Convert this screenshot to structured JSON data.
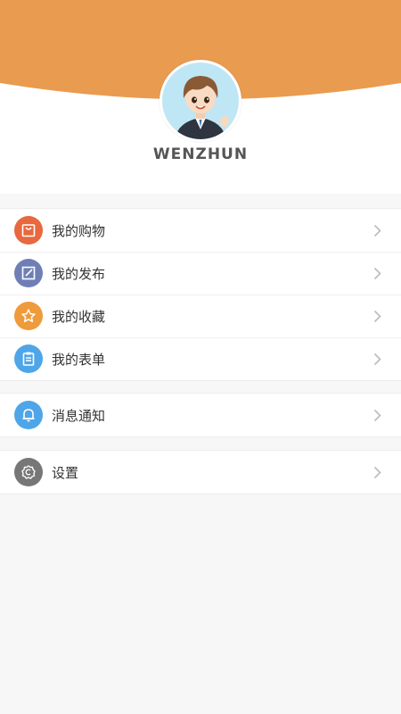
{
  "profile": {
    "username": "WENZHUN",
    "header_color": "#E99B50"
  },
  "menu_group_1": [
    {
      "label": "我的购物",
      "icon": "shopping-bag-icon",
      "color": "#E8683F"
    },
    {
      "label": "我的发布",
      "icon": "edit-icon",
      "color": "#6F7FB6"
    },
    {
      "label": "我的收藏",
      "icon": "star-icon",
      "color": "#EF9A3B"
    },
    {
      "label": "我的表单",
      "icon": "clipboard-icon",
      "color": "#4EA6E8"
    }
  ],
  "menu_group_2": [
    {
      "label": "消息通知",
      "icon": "bell-icon",
      "color": "#4EA6E8"
    }
  ],
  "menu_group_3": [
    {
      "label": "设置",
      "icon": "settings-icon",
      "color": "#777777"
    }
  ]
}
